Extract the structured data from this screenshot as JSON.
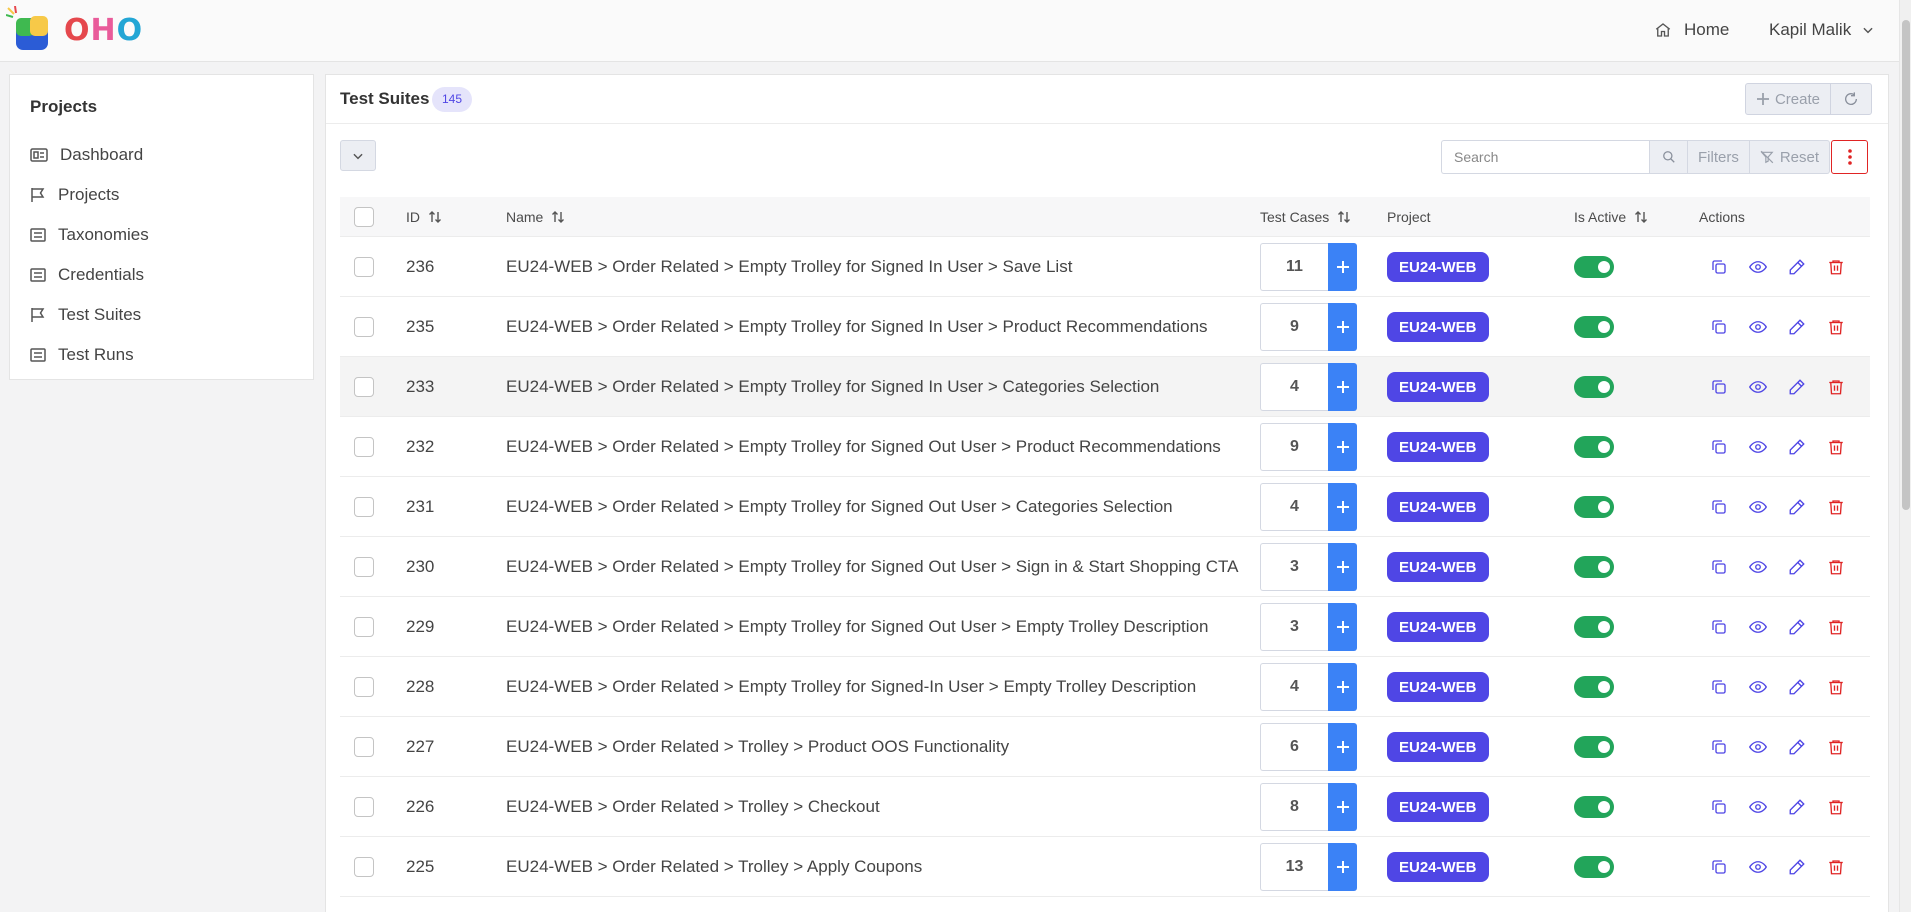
{
  "app": {
    "logo_text": "OHO"
  },
  "topbar": {
    "home_label": "Home",
    "user_name": "Kapil Malik"
  },
  "sidebar": {
    "title": "Projects",
    "items": [
      {
        "label": "Dashboard",
        "icon": "dashboard-icon"
      },
      {
        "label": "Projects",
        "icon": "flag-icon"
      },
      {
        "label": "Taxonomies",
        "icon": "list-icon"
      },
      {
        "label": "Credentials",
        "icon": "list-icon"
      },
      {
        "label": "Test Suites",
        "icon": "flag-icon"
      },
      {
        "label": "Test Runs",
        "icon": "list-icon"
      }
    ]
  },
  "main": {
    "title": "Test Suites",
    "count": "145",
    "create_label": "Create",
    "search_placeholder": "Search",
    "filters_label": "Filters",
    "reset_label": "Reset"
  },
  "table": {
    "columns": {
      "id": "ID",
      "name": "Name",
      "test_cases": "Test Cases",
      "project": "Project",
      "is_active": "Is Active",
      "actions": "Actions"
    },
    "rows": [
      {
        "id": "236",
        "name": "EU24-WEB > Order Related > Empty Trolley for Signed In User > Save List",
        "test_cases": "11",
        "project": "EU24-WEB",
        "active": true
      },
      {
        "id": "235",
        "name": "EU24-WEB > Order Related > Empty Trolley for Signed In User > Product Recommendations",
        "test_cases": "9",
        "project": "EU24-WEB",
        "active": true
      },
      {
        "id": "233",
        "name": "EU24-WEB > Order Related > Empty Trolley for Signed In User > Categories Selection",
        "test_cases": "4",
        "project": "EU24-WEB",
        "active": true
      },
      {
        "id": "232",
        "name": "EU24-WEB > Order Related > Empty Trolley for Signed Out User > Product Recommendations",
        "test_cases": "9",
        "project": "EU24-WEB",
        "active": true
      },
      {
        "id": "231",
        "name": "EU24-WEB > Order Related > Empty Trolley for Signed Out User > Categories Selection",
        "test_cases": "4",
        "project": "EU24-WEB",
        "active": true
      },
      {
        "id": "230",
        "name": "EU24-WEB > Order Related > Empty Trolley for Signed Out User > Sign in & Start Shopping CTA",
        "test_cases": "3",
        "project": "EU24-WEB",
        "active": true
      },
      {
        "id": "229",
        "name": "EU24-WEB > Order Related > Empty Trolley for Signed Out User > Empty Trolley Description",
        "test_cases": "3",
        "project": "EU24-WEB",
        "active": true
      },
      {
        "id": "228",
        "name": "EU24-WEB > Order Related > Empty Trolley for Signed-In User > Empty Trolley Description",
        "test_cases": "4",
        "project": "EU24-WEB",
        "active": true
      },
      {
        "id": "227",
        "name": "EU24-WEB > Order Related > Trolley > Product OOS Functionality",
        "test_cases": "6",
        "project": "EU24-WEB",
        "active": true
      },
      {
        "id": "226",
        "name": "EU24-WEB > Order Related > Trolley > Checkout",
        "test_cases": "8",
        "project": "EU24-WEB",
        "active": true
      },
      {
        "id": "225",
        "name": "EU24-WEB > Order Related > Trolley > Apply Coupons",
        "test_cases": "13",
        "project": "EU24-WEB",
        "active": true
      }
    ]
  },
  "colors": {
    "accent": "#4f46e5",
    "add_button": "#3b82f6",
    "toggle_on": "#22a55a",
    "delete": "#e02424",
    "count_badge_bg": "#e5e4fb"
  }
}
